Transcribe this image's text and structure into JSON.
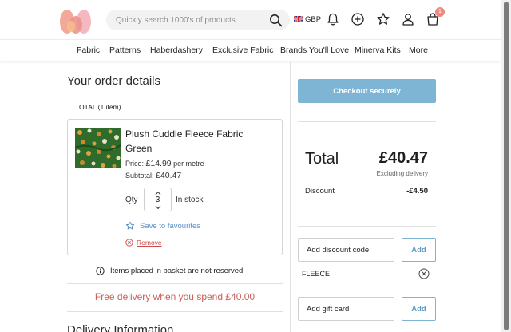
{
  "header": {
    "search": {
      "placeholder": "Quickly search 1000's of products"
    },
    "currency": "GBP",
    "basket_count": "1",
    "icons": [
      "logo",
      "search-icon",
      "uk-flag-icon",
      "bell-icon",
      "add-circle-icon",
      "star-icon",
      "user-icon",
      "basket-icon"
    ]
  },
  "nav": {
    "items": [
      {
        "label": "Fabric"
      },
      {
        "label": "Patterns"
      },
      {
        "label": "Haberdashery"
      },
      {
        "label": "Exclusive Fabric"
      },
      {
        "label": "Brands You'll Love"
      },
      {
        "label": "Minerva Kits"
      },
      {
        "label": "More"
      }
    ]
  },
  "order": {
    "title": "Your order details",
    "count": "TOTAL (1 item)",
    "item": {
      "name": "Plush Cuddle Fleece Fabric Green",
      "price_label": "Price:",
      "price": "£14.99",
      "price_unit": "per metre",
      "subtotal_label": "Subtotal:",
      "subtotal": "£40.47",
      "qty_label": "Qty",
      "qty": "3",
      "stock": "In stock",
      "favourite": "Save to favourites",
      "remove": "Remove"
    },
    "notice": "Items placed in basket are not reserved",
    "free_delivery": "Free delivery when you spend £40.00",
    "delivery_heading": "Delivery Information"
  },
  "summary": {
    "checkout": "Checkout securely",
    "total_label": "Total",
    "total_value": "£40.47",
    "excluding": "Excluding delivery",
    "discount_label": "Discount",
    "discount_value": "-£4.50",
    "discount_code_placeholder": "Add discount code",
    "add_label": "Add",
    "applied_code": "FLEECE",
    "gift_card_placeholder": "Add gift card"
  },
  "colors": {
    "accent_blue": "#7eb4d4",
    "free_delivery_red": "#c9605a",
    "remove_red": "#c94b4b",
    "badge": "#f08a7f"
  }
}
